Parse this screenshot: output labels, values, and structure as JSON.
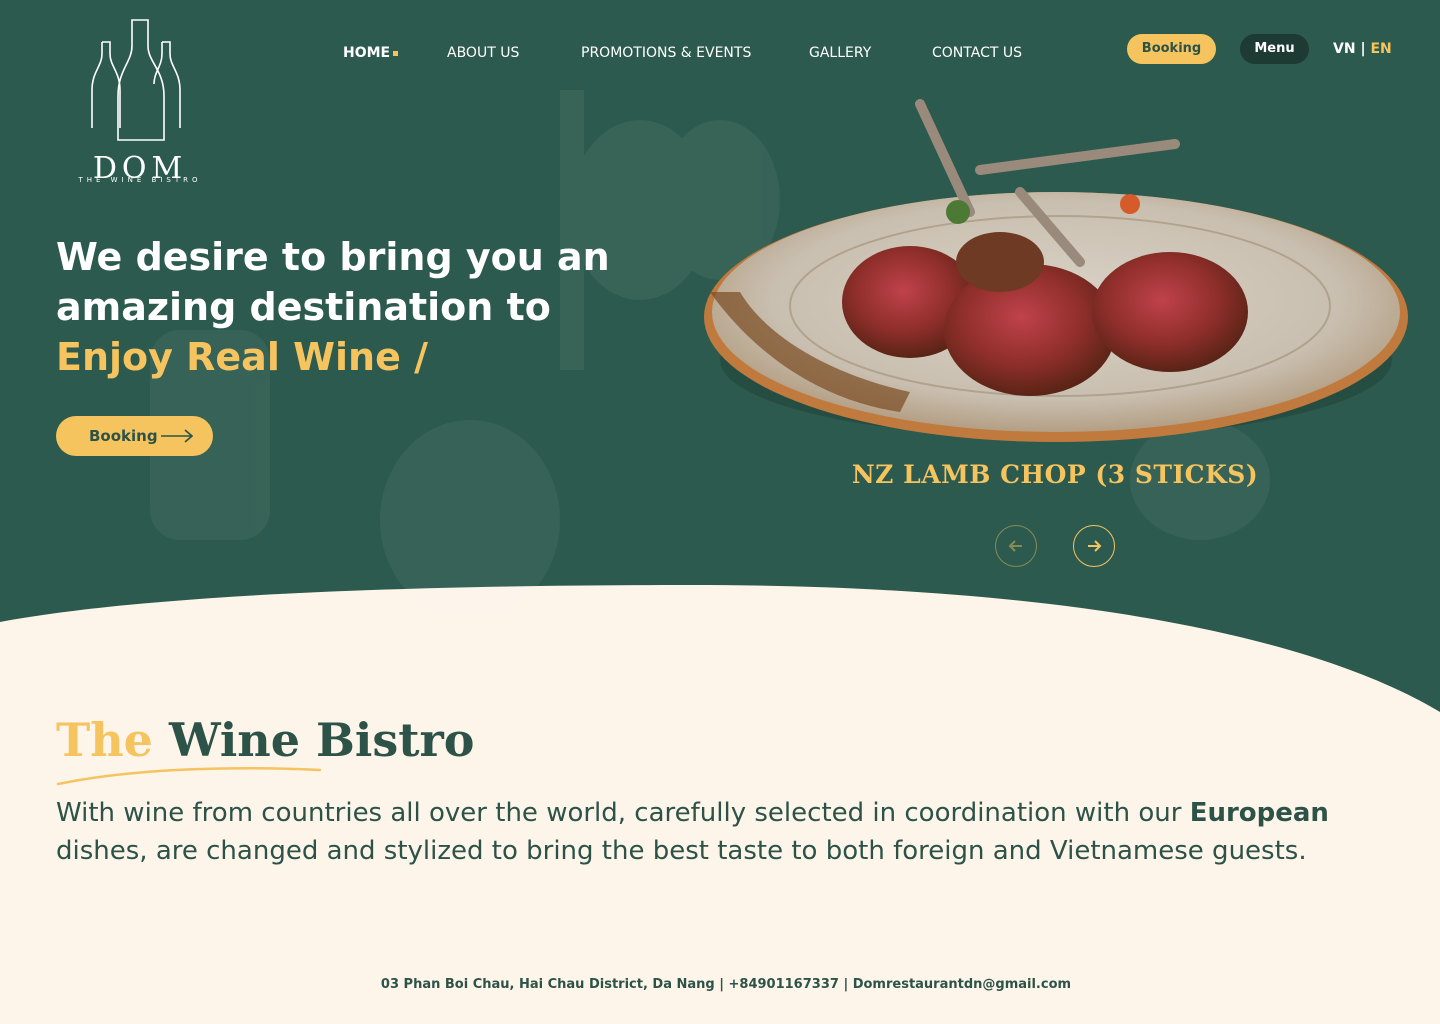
{
  "brand": {
    "name": "DOM",
    "tagline": "THE WINE BISTRO"
  },
  "nav": {
    "items": [
      {
        "label": "HOME",
        "active": true
      },
      {
        "label": "ABOUT US",
        "active": false
      },
      {
        "label": "PROMOTIONS & EVENTS",
        "active": false
      },
      {
        "label": "GALLERY",
        "active": false
      },
      {
        "label": "CONTACT US",
        "active": false
      }
    ]
  },
  "header": {
    "booking_label": "Booking",
    "menu_label": "Menu",
    "lang_vn": "VN",
    "lang_sep": "|",
    "lang_en": "EN"
  },
  "hero": {
    "headline_line1": "We desire to bring you an",
    "headline_line2": "amazing destination to",
    "headline_accent": "Enjoy Real Wine /",
    "booking_label": "Booking",
    "dish_name": "NZ LAMB CHOP (3 STICKS)"
  },
  "bistro": {
    "title_part1": "The",
    "title_part2": "Wine Bistro",
    "desc_before": "With wine from countries all over the world, carefully selected in coordination with our ",
    "desc_bold": "European",
    "desc_after": " dishes, are changed and stylized to bring the best taste to both foreign and Vietnamese guests."
  },
  "footer": {
    "info": "03 Phan Boi Chau, Hai Chau District, Da Nang | +84901167337 | Domrestaurantdn@gmail.com"
  },
  "colors": {
    "green": "#2d5a4e",
    "dark_green": "#1d3b33",
    "gold": "#f5c45e",
    "cream": "#fdf4ea"
  }
}
